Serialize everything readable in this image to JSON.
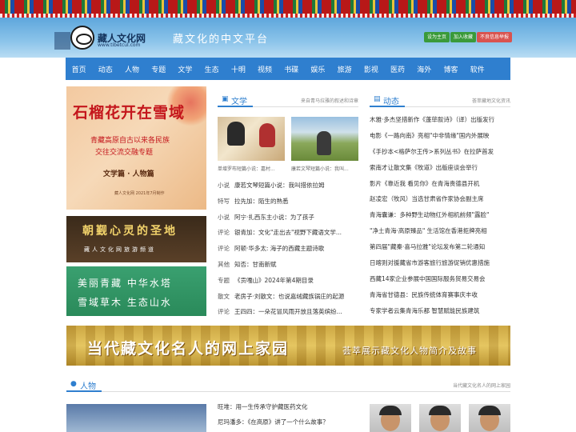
{
  "header": {
    "logo_title": "藏人文化网",
    "logo_url": "www.tibetcul.com",
    "slogan": "藏文化的中文平台",
    "buttons": [
      "设为主页",
      "加入收藏",
      "不良信息举报"
    ],
    "colors": {
      "nav": "#2f7fcf",
      "accent_red": "#c4161c",
      "btn_green": "#3a9a3a",
      "btn_red": "#d9534f"
    }
  },
  "nav": [
    "首页",
    "动态",
    "人物",
    "专题",
    "文学",
    "生态",
    "十明",
    "视频",
    "书碟",
    "娱乐",
    "旅游",
    "影视",
    "医药",
    "海外",
    "博客",
    "软件"
  ],
  "banners": {
    "pomegranate": {
      "title": "石榴花开在雪域",
      "sub1": "青藏高原自古以来各民族",
      "sub2": "交往交流交融专题",
      "tag": "文学篇 · 人物篇",
      "foot": "藏人文化网  2021年7月制作"
    },
    "pilgrimage": {
      "title": "朝觐心灵的圣地",
      "sub": "藏人文化网旅游频道"
    },
    "green": {
      "line1": "美丽青藏  中华水塔",
      "line2": "雪域草木  生态山水"
    }
  },
  "literature": {
    "title": "文学",
    "desc": "来自青马拉雅的叙述和诗章",
    "captions": [
      "单增罗布短篇小说：嘉村...",
      "康若文琴短篇小说：我叫..."
    ],
    "items": [
      {
        "cat": "小说",
        "title": "康若文琴短篇小说：我叫措依拉姆"
      },
      {
        "cat": "特写",
        "title": "拉先加：陌生的熟悉"
      },
      {
        "cat": "小说",
        "title": "阿宁·扎西东主小说：为了孩子"
      },
      {
        "cat": "评论",
        "title": "银青加：文化\"走出去\"视野下藏语文学..."
      },
      {
        "cat": "评论",
        "title": "阿顿·华多太: 海子的西藏主题诗歌"
      },
      {
        "cat": "其他",
        "title": "知否：甘南新赋"
      },
      {
        "cat": "专题",
        "title": "《贡嘎山》2024年第4期目录"
      },
      {
        "cat": "散文",
        "title": "老房子·刘散文：也说嘉绒藏族锅庄的起源"
      },
      {
        "cat": "评论",
        "title": "王四四：一朵花冒风雨开放且落英缤纷..."
      }
    ]
  },
  "news": {
    "title": "动态",
    "desc": "荟萃藏地文化资讯",
    "items": [
      "木雅·多杰坚措新作《蓬荜叙诗》（译）出版发行",
      "电影《一路向南》亮相\"中非情缘\"国内外展映",
      "《手抄本<格萨尔王传>系列丛书》在拉萨首发",
      "索南才让散文集《牧道》出版座谈会举行",
      "影片《靠近我 看见你》在青海贵德县开机",
      "赵凌宏（牧风）当选甘肃省作家协会副主席",
      "青海囊谦：多种野生动物红外相机前频\"露脸\"",
      "\"净土青海·高原臻品\" 生活馆在香港拒牌亮相",
      "第四届\"藏秦·喜马拉雅\"论坛发布第二轮通知",
      "日喀则对援藏省市游客旅行旅游促销优惠措施",
      "西藏14家企业参展中国国际服务贸易交易会",
      "青海省甘德县：民族传统体育赛事庆丰收",
      "专家学者云集青海乐都 智慧赋能民族建筑"
    ]
  },
  "wide_banner": {
    "main": "当代藏文化名人的网上家园",
    "sub": "荟萃展示藏文化人物简介及故事"
  },
  "people": {
    "title": "人物",
    "desc": "当代藏文化名人的网上家园",
    "items": [
      "旺堆：用一生传承守护藏医药文化",
      "尼玛潘多：《在高原》讲了一个什么故事？"
    ]
  }
}
